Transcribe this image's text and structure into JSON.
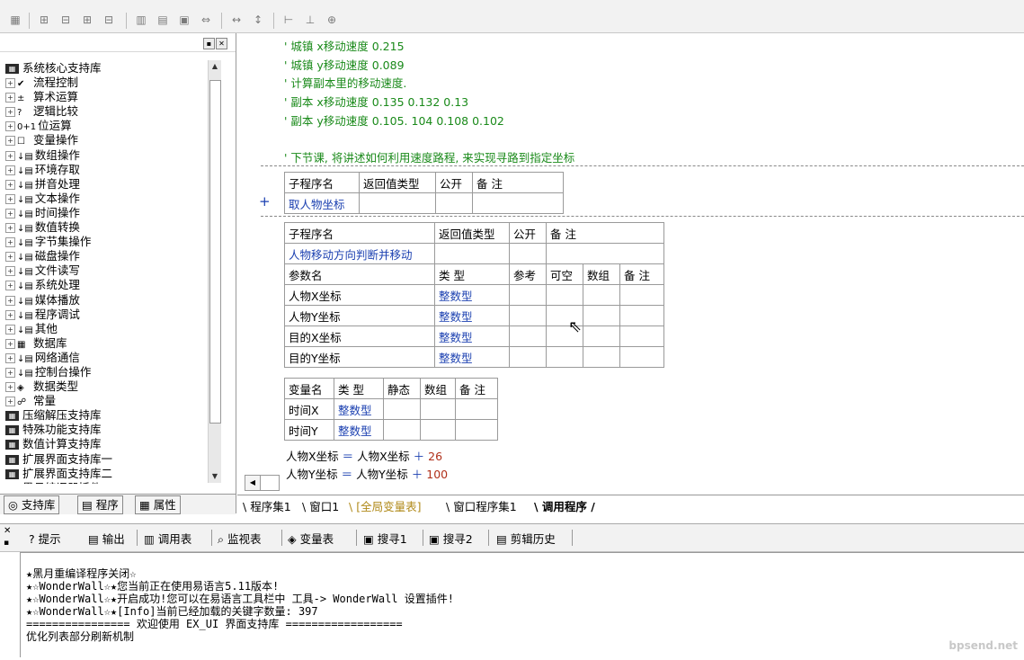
{
  "left_panel": {
    "tree": [
      {
        "icon": "book",
        "label": "系统核心支持库",
        "expander": ""
      },
      {
        "icon": "check",
        "label": "流程控制",
        "expander": "+"
      },
      {
        "icon": "math",
        "label": "算术运算",
        "expander": "+"
      },
      {
        "icon": "question",
        "label": "逻辑比较",
        "expander": "+"
      },
      {
        "icon": "bit",
        "label": "位运算",
        "expander": "+"
      },
      {
        "icon": "var",
        "label": "变量操作",
        "expander": "+"
      },
      {
        "icon": "doc",
        "label": "数组操作",
        "expander": "+"
      },
      {
        "icon": "doc",
        "label": "环境存取",
        "expander": "+"
      },
      {
        "icon": "doc",
        "label": "拼音处理",
        "expander": "+"
      },
      {
        "icon": "doc",
        "label": "文本操作",
        "expander": "+"
      },
      {
        "icon": "doc",
        "label": "时间操作",
        "expander": "+"
      },
      {
        "icon": "doc",
        "label": "数值转换",
        "expander": "+"
      },
      {
        "icon": "doc",
        "label": "字节集操作",
        "expander": "+"
      },
      {
        "icon": "doc",
        "label": "磁盘操作",
        "expander": "+"
      },
      {
        "icon": "doc",
        "label": "文件读写",
        "expander": "+"
      },
      {
        "icon": "doc",
        "label": "系统处理",
        "expander": "+"
      },
      {
        "icon": "doc",
        "label": "媒体播放",
        "expander": "+"
      },
      {
        "icon": "doc",
        "label": "程序调试",
        "expander": "+"
      },
      {
        "icon": "doc",
        "label": "其他",
        "expander": "+"
      },
      {
        "icon": "db",
        "label": "数据库",
        "expander": "+"
      },
      {
        "icon": "doc",
        "label": "网络通信",
        "expander": "+"
      },
      {
        "icon": "doc",
        "label": "控制台操作",
        "expander": "+"
      },
      {
        "icon": "types",
        "label": "数据类型",
        "expander": "+"
      },
      {
        "icon": "const",
        "label": "常量",
        "expander": "+"
      },
      {
        "icon": "book",
        "label": "压缩解压支持库",
        "expander": ""
      },
      {
        "icon": "book",
        "label": "特殊功能支持库",
        "expander": ""
      },
      {
        "icon": "book",
        "label": "数值计算支持库",
        "expander": ""
      },
      {
        "icon": "book",
        "label": "扩展界面支持库一",
        "expander": ""
      },
      {
        "icon": "book",
        "label": "扩展界面支持库二",
        "expander": ""
      },
      {
        "icon": "book",
        "label": "黑月编译器插件",
        "expander": ""
      }
    ],
    "tabs": {
      "support": "支持库",
      "program": "程序",
      "property": "属性"
    }
  },
  "code": {
    "comments": [
      "' 城镇 x移动速度 0.215",
      "' 城镇 y移动速度 0.089",
      "' 计算副本里的移动速度.",
      "' 副本 x移动速度 0.135    0.132 0.13",
      "' 副本 y移动速度 0.105.   104 0.108  0.102",
      "' 下节课, 将讲述如何利用速度路程, 来实现寻路到指定坐标"
    ],
    "sub1": {
      "headers": [
        "子程序名",
        "返回值类型",
        "公开",
        "备 注"
      ],
      "row": [
        "取人物坐标",
        "",
        "",
        ""
      ]
    },
    "sub2": {
      "headers": [
        "子程序名",
        "返回值类型",
        "公开",
        "备 注"
      ],
      "row": [
        "人物移动方向判断并移动",
        "",
        "",
        ""
      ],
      "param_headers": [
        "参数名",
        "类 型",
        "参考",
        "可空",
        "数组",
        "备 注"
      ],
      "params": [
        [
          "人物X坐标",
          "整数型"
        ],
        [
          "人物Y坐标",
          "整数型"
        ],
        [
          "目的X坐标",
          "整数型"
        ],
        [
          "目的Y坐标",
          "整数型"
        ]
      ]
    },
    "vars": {
      "headers": [
        "变量名",
        "类 型",
        "静态",
        "数组",
        "备 注"
      ],
      "rows": [
        [
          "时间X",
          "整数型"
        ],
        [
          "时间Y",
          "整数型"
        ]
      ]
    },
    "lines": [
      {
        "lhs": "人物X坐标",
        "op": "＝",
        "rhs": "人物X坐标",
        "plus": "＋",
        "num": "26"
      },
      {
        "lhs": "人物Y坐标",
        "op": "＝",
        "rhs": "人物Y坐标",
        "plus": "＋",
        "num": "100"
      }
    ],
    "tabs": [
      "程序集1",
      "窗口1",
      "[全局变量表]",
      "窗口程序集1",
      "调用程序"
    ]
  },
  "bottom": {
    "tabs": [
      "提示",
      "输出",
      "调用表",
      "监视表",
      "变量表",
      "搜寻1",
      "搜寻2",
      "剪辑历史"
    ],
    "output": [
      "★黑月重编译程序关闭☆",
      "★☆WonderWall☆★您当前正在使用易语言5.11版本!",
      "★☆WonderWall☆★开启成功!您可以在易语言工具栏中 工具-> WonderWall 设置插件!",
      "★☆WonderWall☆★[Info]当前已经加载的关键字数量: 397",
      "================ 欢迎使用  EX_UI 界面支持库 ==================",
      "优化列表部分刷新机制"
    ],
    "watermark": "bpsend.net"
  }
}
